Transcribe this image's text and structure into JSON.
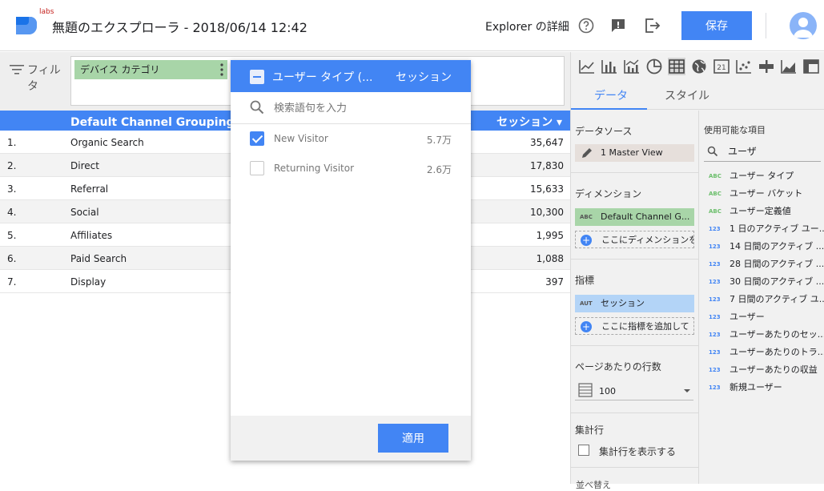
{
  "header": {
    "labs": "labs",
    "title": "無題のエクスプローラ - 2018/06/14 12:42",
    "explorer_detail": "Explorer の詳細",
    "save_label": "保存"
  },
  "filter": {
    "label": "フィルタ",
    "chip_label": "デバイス カテゴリ"
  },
  "table": {
    "col_dimension": "Default Channel Grouping (デフ",
    "col_metric": "セッション ▾",
    "rows": [
      {
        "idx": "1.",
        "name": "Organic Search",
        "value": "35,647"
      },
      {
        "idx": "2.",
        "name": "Direct",
        "value": "17,830"
      },
      {
        "idx": "3.",
        "name": "Referral",
        "value": "15,633"
      },
      {
        "idx": "4.",
        "name": "Social",
        "value": "10,300"
      },
      {
        "idx": "5.",
        "name": "Affiliates",
        "value": "1,995"
      },
      {
        "idx": "6.",
        "name": "Paid Search",
        "value": "1,088"
      },
      {
        "idx": "7.",
        "name": "Display",
        "value": "397"
      }
    ]
  },
  "dropdown": {
    "header_dimension": "ユーザー タイプ (...",
    "header_metric": "セッション",
    "search_placeholder": "検索語句を入力",
    "items": [
      {
        "label": "New Visitor",
        "count": "5.7万",
        "checked": true
      },
      {
        "label": "Returning Visitor",
        "count": "2.6万",
        "checked": false
      }
    ],
    "apply_label": "適用"
  },
  "panel": {
    "tabs": [
      "データ",
      "スタイル"
    ],
    "datasource_title": "データソース",
    "datasource_value": "1 Master View",
    "dimension_title": "ディメンション",
    "dimension_value": "Default Channel G...",
    "dimension_add": "ここにディメンションを",
    "metric_title": "指標",
    "metric_tag": "AUT",
    "metric_value": "セッション",
    "metric_add": "ここに指標を追加して",
    "rows_title": "ページあたりの行数",
    "rows_value": "100",
    "total_title": "集計行",
    "total_checkbox_label": "集計行を表示する",
    "cut_text": "並べ替え",
    "available_title": "使用可能な項目",
    "available_search": "ユーザ",
    "available_items": [
      {
        "tag": "ABC",
        "kind": "abc",
        "label": "ユーザー タイプ"
      },
      {
        "tag": "ABC",
        "kind": "abc",
        "label": "ユーザー バケット"
      },
      {
        "tag": "ABC",
        "kind": "abc",
        "label": "ユーザー定義値"
      },
      {
        "tag": "123",
        "kind": "num",
        "label": "1 日のアクティブ ユー..."
      },
      {
        "tag": "123",
        "kind": "num",
        "label": "14 日間のアクティブ ..."
      },
      {
        "tag": "123",
        "kind": "num",
        "label": "28 日間のアクティブ ..."
      },
      {
        "tag": "123",
        "kind": "num",
        "label": "30 日間のアクティブ ..."
      },
      {
        "tag": "123",
        "kind": "num",
        "label": "7 日間のアクティブ ユ..."
      },
      {
        "tag": "123",
        "kind": "num",
        "label": "ユーザー"
      },
      {
        "tag": "123",
        "kind": "num",
        "label": "ユーザーあたりのセッ..."
      },
      {
        "tag": "123",
        "kind": "num",
        "label": "ユーザーあたりのトラ..."
      },
      {
        "tag": "123",
        "kind": "num",
        "label": "ユーザーあたりの収益"
      },
      {
        "tag": "123",
        "kind": "num",
        "label": "新規ユーザー"
      }
    ]
  },
  "icons": {
    "help": "help-icon",
    "feedback": "feedback-icon",
    "exit": "exit-icon",
    "chart_types": [
      "line-chart-icon",
      "bar-chart-icon",
      "combo-chart-icon",
      "pie-chart-icon",
      "table-chart-icon",
      "geo-chart-icon",
      "scorecard-icon",
      "scatter-chart-icon",
      "bullet-chart-icon",
      "area-chart-icon",
      "pivot-table-icon"
    ]
  },
  "colors": {
    "accent": "#4285f4",
    "dimension": "#a8d5a8",
    "metric": "#b3d4f7"
  }
}
